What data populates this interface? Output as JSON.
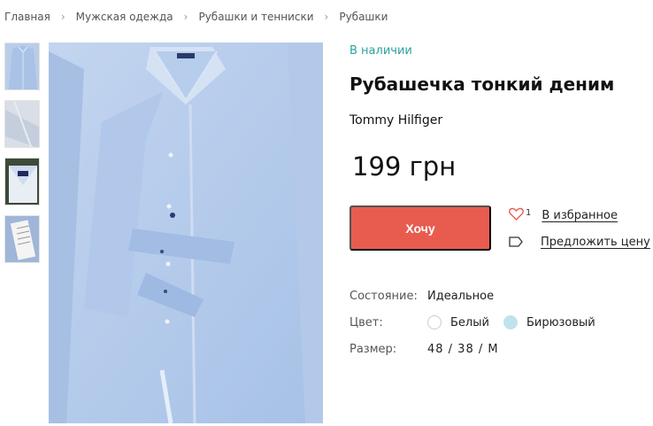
{
  "breadcrumb": {
    "items": [
      "Главная",
      "Мужская одежда",
      "Рубашки и тенниски",
      "Рубашки"
    ],
    "separator": "›"
  },
  "gallery": {
    "thumbnails": [
      "shirt-front",
      "shirt-fabric",
      "shirt-collar-label",
      "shirt-care-label"
    ],
    "main_image": "light-blue-denim-shirt"
  },
  "product": {
    "availability": "В наличии",
    "title": "Рубашечка тонкий деним",
    "brand": "Tommy Hilfiger",
    "price": "199 грн"
  },
  "actions": {
    "want_label": "Хочу",
    "favorites_count": "1",
    "favorites_label": "В избранное",
    "offer_price_label": "Предложить цену"
  },
  "properties": {
    "condition_label": "Состояние:",
    "condition_value": "Идеальное",
    "color_label": "Цвет:",
    "colors": [
      {
        "name": "Белый",
        "hex": "#ffffff"
      },
      {
        "name": "Бирюзовый",
        "hex": "#bfe3ec"
      }
    ],
    "size_label": "Размер:",
    "size_value": "48 / 38 / M"
  },
  "colors": {
    "accent": "#e85c50",
    "availability": "#2aa39b"
  }
}
